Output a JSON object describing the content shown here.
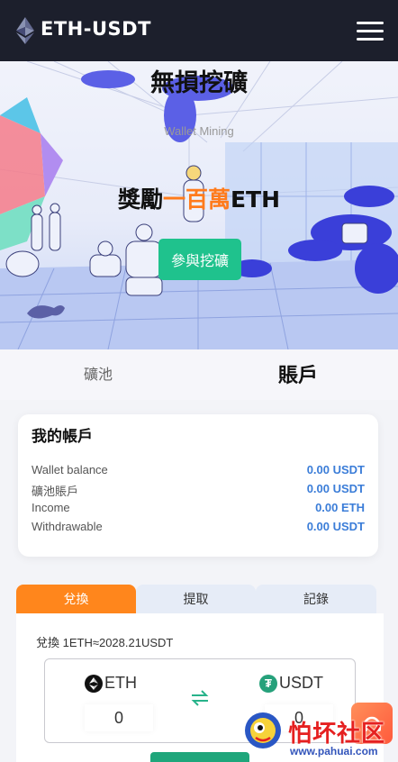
{
  "header": {
    "title": "ETH-USDT",
    "logo_icon": "ethereum-icon",
    "menu_icon": "hamburger-menu-icon"
  },
  "hero": {
    "title": "無損挖礦",
    "subtitle": "Wallet Mining",
    "reward_prefix": "獎勵",
    "reward_highlight": "一百萬",
    "reward_suffix": "ETH",
    "join_label": "參與挖礦",
    "accent_color": "#ff7b1c",
    "button_color": "#1fc28d"
  },
  "main_tabs": {
    "pool_label": "礦池",
    "account_label": "賬戶",
    "active": "account"
  },
  "account": {
    "title": "我的帳戶",
    "rows": [
      {
        "label": "Wallet balance",
        "value": "0.00 USDT"
      },
      {
        "label": "礦池賬戶",
        "value": "0.00 USDT"
      },
      {
        "label": "Income",
        "value": "0.00 ETH"
      },
      {
        "label": "Withdrawable",
        "value": "0.00 USDT"
      }
    ]
  },
  "exchange": {
    "tabs": [
      "兌換",
      "提取",
      "記錄"
    ],
    "active_tab": "兌換",
    "rate_text": "兌換 1ETH≈2028.21USDT",
    "from_coin": "ETH",
    "to_coin": "USDT",
    "from_amount": "0",
    "to_amount": "0",
    "active_color": "#ff861c"
  },
  "watermark": {
    "text": "怕坏社区",
    "url": "www.pahuai.com"
  }
}
